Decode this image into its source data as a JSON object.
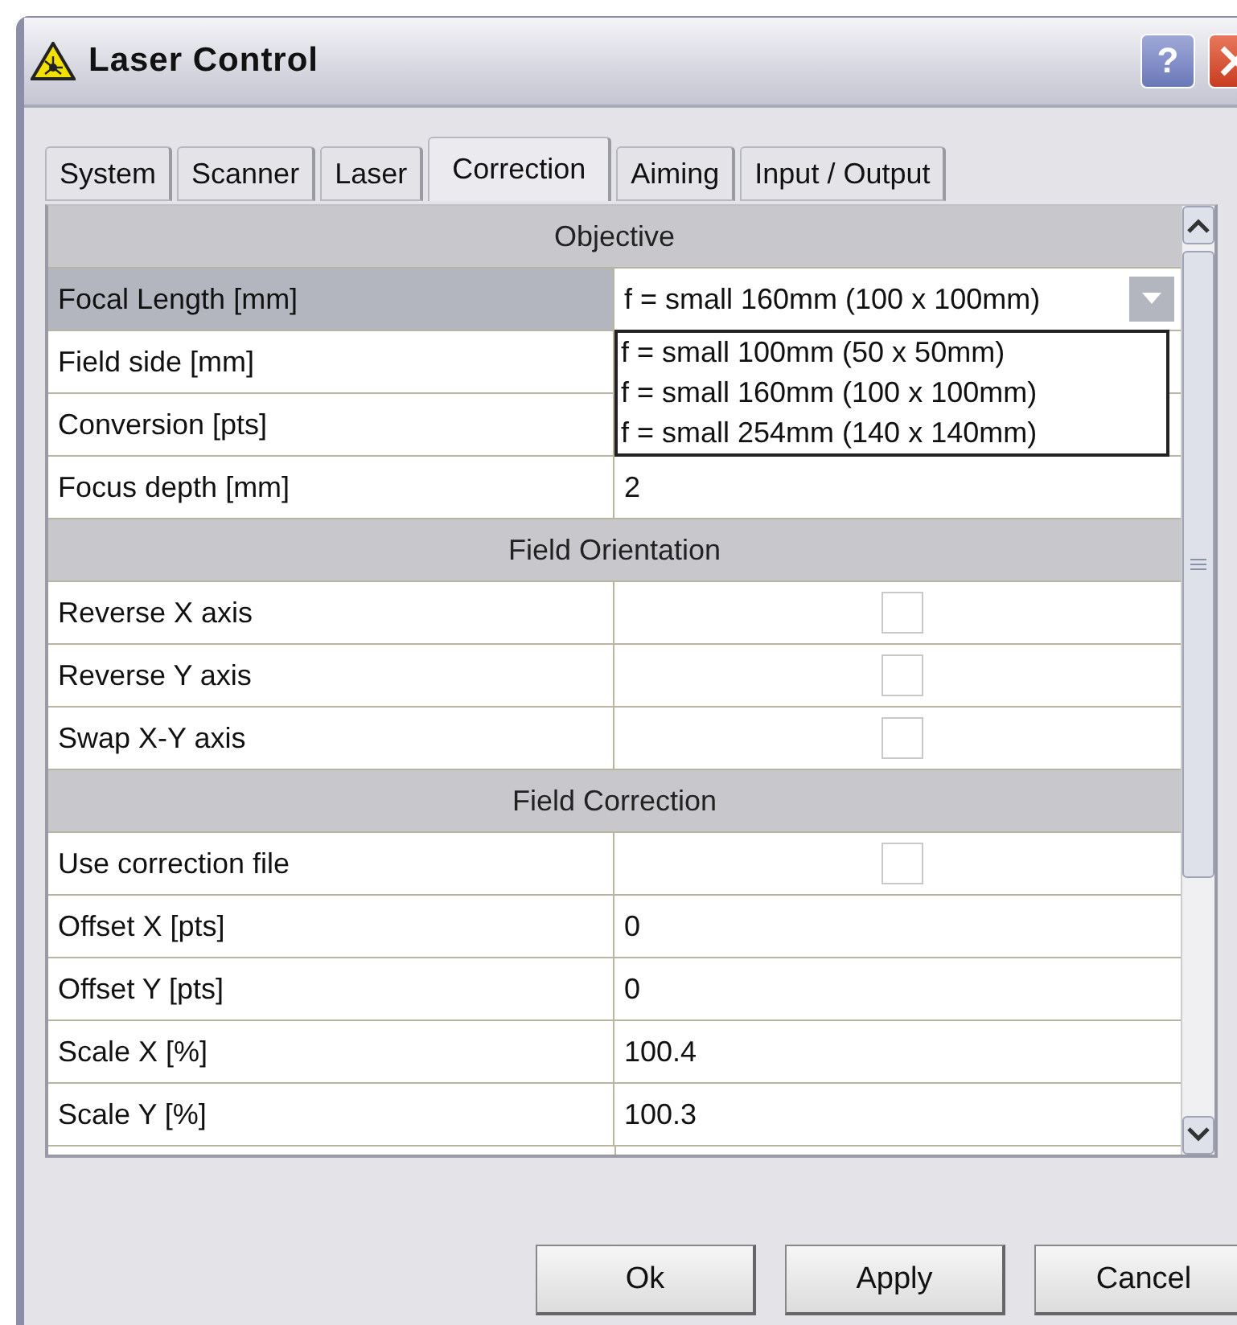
{
  "window": {
    "title": "Laser Control",
    "help": "?"
  },
  "tabs": [
    {
      "label": "System",
      "selected": false
    },
    {
      "label": "Scanner",
      "selected": false
    },
    {
      "label": "Laser",
      "selected": false
    },
    {
      "label": "Correction",
      "selected": true
    },
    {
      "label": "Aiming",
      "selected": false
    },
    {
      "label": "Input / Output",
      "selected": false
    }
  ],
  "sections": [
    {
      "title": "Objective",
      "rows": [
        {
          "kind": "combo",
          "label": "Focal Length [mm]",
          "value": "f = small 160mm (100 x 100mm)",
          "selected": true,
          "options": [
            "f = small 100mm (50 x 50mm)",
            "f = small 160mm (100 x 100mm)",
            "f = small 254mm (140 x 140mm)"
          ]
        },
        {
          "kind": "text",
          "label": "Field side [mm]",
          "selected": false
        },
        {
          "kind": "text",
          "label": "Conversion [pts]",
          "selected": false
        },
        {
          "kind": "text",
          "label": "Focus depth [mm]",
          "value": "2",
          "selected": false
        }
      ]
    },
    {
      "title": "Field Orientation",
      "rows": [
        {
          "kind": "check",
          "label": "Reverse X axis",
          "checked": false,
          "selected": false
        },
        {
          "kind": "check",
          "label": "Reverse Y axis",
          "checked": false,
          "selected": false
        },
        {
          "kind": "check",
          "label": "Swap X-Y axis",
          "checked": false,
          "selected": false
        }
      ]
    },
    {
      "title": "Field Correction",
      "rows": [
        {
          "kind": "check",
          "label": "Use correction file",
          "checked": false,
          "selected": false
        },
        {
          "kind": "text",
          "label": "Offset X [pts]",
          "value": "0",
          "selected": false
        },
        {
          "kind": "text",
          "label": "Offset Y [pts]",
          "value": "0",
          "selected": false
        },
        {
          "kind": "text",
          "label": "Scale X [%]",
          "value": "100.4",
          "selected": false
        },
        {
          "kind": "text",
          "label": "Scale Y [%]",
          "value": "100.3",
          "selected": false
        }
      ]
    }
  ],
  "buttons": [
    "Ok",
    "Apply",
    "Cancel"
  ]
}
